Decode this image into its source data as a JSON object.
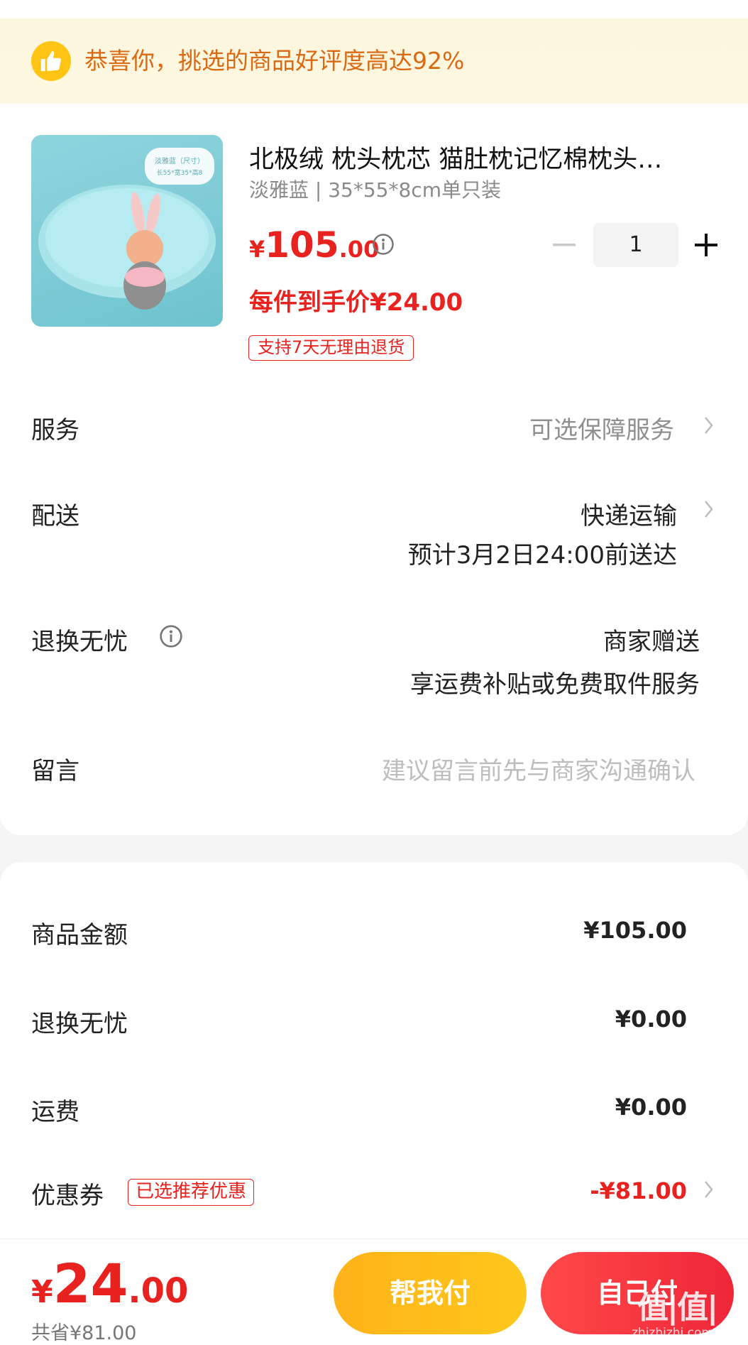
{
  "banner": {
    "icon": "thumbs-up-icon",
    "text": "恭喜你，挑选的商品好评度高达92%"
  },
  "product": {
    "title": "北极绒 枕头枕芯 猫肚枕记忆棉枕头…",
    "sku": "淡雅蓝 | 35*55*8cm单只装",
    "price_symbol": "¥",
    "price_int": "105",
    "price_dec": ".00",
    "quantity": "1",
    "hand_price": "每件到手价¥24.00",
    "return_tag": "支持7天无理由退货",
    "image_label_1": "淡雅蓝（尺寸）",
    "image_label_2": "长55*宽35*高8"
  },
  "rows": {
    "service_label": "服务",
    "service_value": "可选保障服务",
    "delivery_label": "配送",
    "delivery_value": "快递运输",
    "delivery_eta": "预计3月2日24:00前送达",
    "return_label": "退换无忧",
    "return_value": "商家赠送",
    "return_desc": "享运费补贴或免费取件服务",
    "message_label": "留言",
    "message_placeholder": "建议留言前先与商家沟通确认"
  },
  "summary": {
    "goods_label": "商品金额",
    "goods_value": "¥105.00",
    "return_label": "退换无忧",
    "return_value": "¥0.00",
    "shipping_label": "运费",
    "shipping_value": "¥0.00",
    "coupon_label": "优惠券",
    "coupon_tag": "已选推荐优惠",
    "coupon_value": "-¥81.00"
  },
  "bottom": {
    "total_symbol": "¥",
    "total_int": "24",
    "total_dec": ".00",
    "saved": "共省¥81.00",
    "help_pay": "帮我付",
    "self_pay": "自己付",
    "watermark": "值|值|值",
    "watermark_url": "zhizhizhi.com"
  },
  "colors": {
    "accent_red": "#e8231f",
    "banner_text": "#d96a12",
    "help_button": "#ffc01a",
    "self_button": "#f23040"
  }
}
